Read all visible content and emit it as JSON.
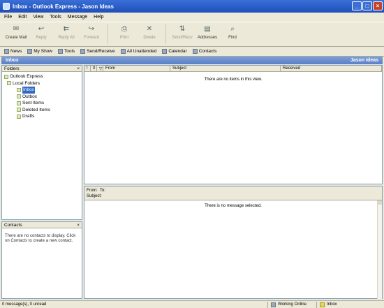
{
  "window": {
    "title": "Inbox - Outlook Express - Jason Ideas",
    "min": "_",
    "max": "□",
    "close": "×"
  },
  "menu": [
    "File",
    "Edit",
    "View",
    "Tools",
    "Message",
    "Help"
  ],
  "toolbar": {
    "create_mail": "Create Mail",
    "reply": "Reply",
    "reply_all": "Reply All",
    "forward": "Forward",
    "print": "Print",
    "delete": "Delete",
    "send_recv": "Send/Recv",
    "addresses": "Addresses",
    "find": "Find"
  },
  "viewsbar": [
    "News",
    "My Show",
    "Tools",
    "Send/Receive",
    "All Unattended",
    "Calendar",
    "Contacts"
  ],
  "folderbar": {
    "title": "Inbox",
    "identity": "Jason Ideas"
  },
  "folders": {
    "header": "Folders",
    "close": "×",
    "items": [
      "Outlook Express",
      "Local Folders",
      "Inbox",
      "Outbox",
      "Sent Items",
      "Deleted Items",
      "Drafts"
    ]
  },
  "contacts": {
    "header": "Contacts",
    "close": "×",
    "empty_text": "There are no contacts to display. Click on Contacts to create a new contact."
  },
  "list": {
    "columns": [
      "!",
      "0",
      "▽",
      "From",
      "Subject",
      "Received"
    ],
    "empty_text": "There are no items in this view."
  },
  "preview": {
    "from_label": "From:",
    "to_label": "To:",
    "subject_label": "Subject:",
    "empty_text": "There is no message selected."
  },
  "status": {
    "messages": "0 message(s), 0 unread",
    "connection": "Working Online",
    "folder": "Inbox"
  }
}
